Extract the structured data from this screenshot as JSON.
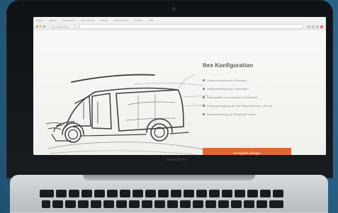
{
  "scene": {
    "laptop_model": "MacBook Pro"
  },
  "browser": {
    "menu_items": [
      "Safari",
      "Ablage",
      "Bearbeiten",
      "Darstellung",
      "Verlauf",
      "Lesezeichen",
      "Fenster",
      "Hilfe"
    ],
    "tab_label": "ihre-konfiguration"
  },
  "page": {
    "title": "Ihre Konfiguration",
    "items": [
      "Seitenverkleidung für Fahrzeug",
      "Seitenverkleidung für Ladeboden",
      "Bodenplatte aus Aluminium-Tränenblech",
      "Anhängerkupplung für den Zwischenboden (-50 cm)",
      "Wandverkleidung an Schiebetür rechts"
    ],
    "cta_label": "IN Angebot anfragen"
  },
  "colors": {
    "accent": "#df6735",
    "text": "#595959",
    "muted": "#8b8b8b"
  }
}
